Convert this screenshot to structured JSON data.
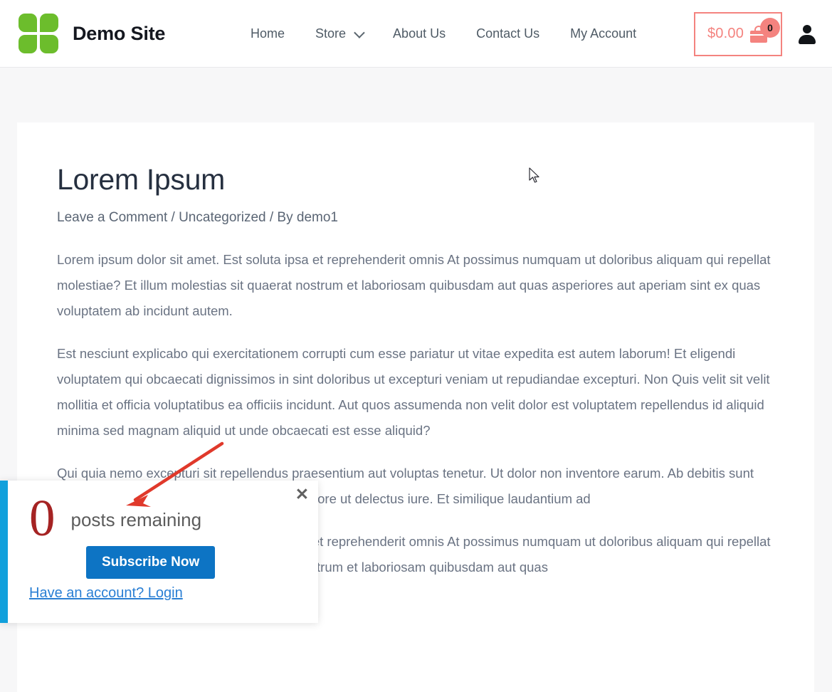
{
  "header": {
    "brand_title": "Demo Site",
    "logo_color": "#6cbd2c",
    "nav": [
      {
        "label": "Home",
        "has_dropdown": false
      },
      {
        "label": "Store",
        "has_dropdown": true
      },
      {
        "label": "About Us",
        "has_dropdown": false
      },
      {
        "label": "Contact Us",
        "has_dropdown": false
      },
      {
        "label": "My Account",
        "has_dropdown": false
      }
    ],
    "cart": {
      "amount": "$0.00",
      "badge_count": "0",
      "accent_color": "#f4837f"
    }
  },
  "article": {
    "title": "Lorem Ipsum",
    "meta": "Leave a Comment / Uncategorized / By demo1",
    "paragraphs": [
      "Lorem ipsum dolor sit amet. Est soluta ipsa et reprehenderit omnis At possimus numquam ut doloribus aliquam qui repellat molestiae? Et illum molestias sit quaerat nostrum et laboriosam quibusdam aut quas asperiores aut aperiam sint ex quas voluptatem ab incidunt autem.",
      "Est nesciunt explicabo qui exercitationem corrupti cum esse pariatur ut vitae expedita est autem laborum! Et eligendi voluptatem qui obcaecati dignissimos in sint doloribus ut excepturi veniam ut repudiandae excepturi. Non Quis velit sit velit mollitia et officia voluptatibus ea officiis incidunt. Aut quos assumenda non velit dolor est voluptatem repellendus id aliquid minima sed magnam aliquid ut unde obcaecati est esse aliquid?",
      "Qui quia nemo excepturi sit repellendus praesentium aut voluptas tenetur. Ut dolor non inventore earum. Ab debitis sunt qui cupiditate delectus non sed earum inventore ut delectus iure. Et similique laudantium ad",
      "Lorem ipsum dolor sit amet. Est soluta ipsa et reprehenderit omnis At possimus numquam ut doloribus aliquam qui repellat molestiae? Et illum molestias sit quaerat nostrum et laboriosam quibusdam aut quas"
    ]
  },
  "subscribe_modal": {
    "posts_count": "0",
    "posts_label": "posts remaining",
    "subscribe_button": "Subscribe Now",
    "login_link": "Have an account? Login",
    "close_glyph": "✕",
    "accent_bar_color": "#11a0dc",
    "button_color": "#0d74c4",
    "count_color": "#a52323"
  },
  "annotation": {
    "arrow_color": "#e0392b"
  }
}
